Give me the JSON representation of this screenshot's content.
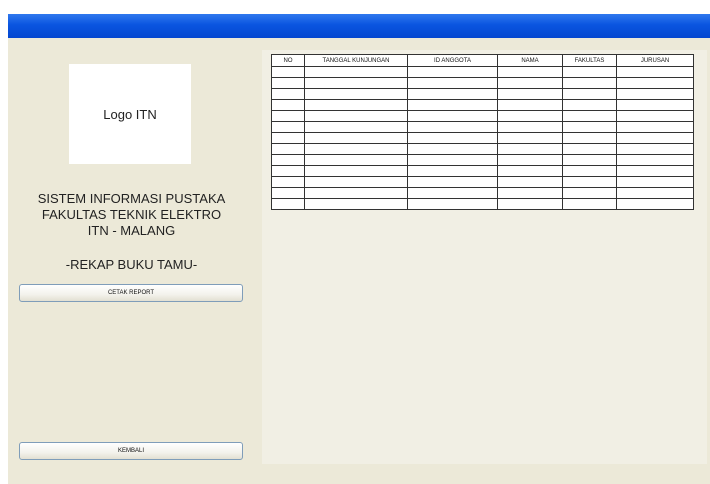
{
  "sidebar": {
    "logo_text": "Logo ITN",
    "title_lines": [
      "SISTEM INFORMASI PUSTAKA",
      "FAKULTAS TEKNIK ELEKTRO",
      "ITN - MALANG"
    ],
    "section_title": "-REKAP BUKU TAMU-",
    "report_button": "CETAK REPORT",
    "back_button": "KEMBALI"
  },
  "table": {
    "columns": [
      "NO",
      "TANGGAL KUNJUNGAN",
      "ID ANGGOTA",
      "NAMA",
      "FAKULTAS",
      "JURUSAN"
    ],
    "rows": [
      [
        "",
        "",
        "",
        "",
        "",
        ""
      ],
      [
        "",
        "",
        "",
        "",
        "",
        ""
      ],
      [
        "",
        "",
        "",
        "",
        "",
        ""
      ],
      [
        "",
        "",
        "",
        "",
        "",
        ""
      ],
      [
        "",
        "",
        "",
        "",
        "",
        ""
      ],
      [
        "",
        "",
        "",
        "",
        "",
        ""
      ],
      [
        "",
        "",
        "",
        "",
        "",
        ""
      ],
      [
        "",
        "",
        "",
        "",
        "",
        ""
      ],
      [
        "",
        "",
        "",
        "",
        "",
        ""
      ],
      [
        "",
        "",
        "",
        "",
        "",
        ""
      ],
      [
        "",
        "",
        "",
        "",
        "",
        ""
      ],
      [
        "",
        "",
        "",
        "",
        "",
        ""
      ],
      [
        "",
        "",
        "",
        "",
        "",
        ""
      ]
    ]
  },
  "colors": {
    "titlebar": "#0a55e0",
    "window_background": "#ece9d8",
    "panel_background": "#f1efe4"
  }
}
